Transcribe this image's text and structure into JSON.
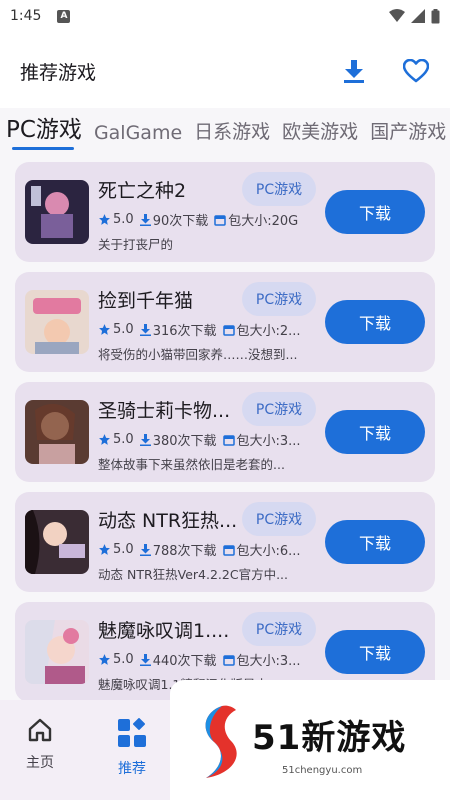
{
  "status": {
    "time": "1:45"
  },
  "header": {
    "title": "推荐游戏",
    "download_icon": "download-icon",
    "favorite_icon": "heart-icon"
  },
  "tabs": [
    {
      "label": "PC游戏",
      "active": true
    },
    {
      "label": "GalGame",
      "active": false
    },
    {
      "label": "日系游戏",
      "active": false
    },
    {
      "label": "欧美游戏",
      "active": false
    },
    {
      "label": "国产游戏",
      "active": false
    }
  ],
  "games": [
    {
      "name": "死亡之种2",
      "tag": "PC游戏",
      "rating": "5.0",
      "downloads": "90次下载",
      "size": "包大小:20G",
      "desc": "关于打丧尸的",
      "button": "下载"
    },
    {
      "name": "捡到千年猫",
      "tag": "PC游戏",
      "rating": "5.0",
      "downloads": "316次下载",
      "size": "包大小:2...",
      "desc": "将受伤的小猫带回家养……没想到...",
      "button": "下载"
    },
    {
      "name": "圣骑士莉卡物...",
      "tag": "PC游戏",
      "rating": "5.0",
      "downloads": "380次下载",
      "size": "包大小:3...",
      "desc": "整体故事下来虽然依旧是老套的...",
      "button": "下载"
    },
    {
      "name": "动态 NTR狂热...",
      "tag": "PC游戏",
      "rating": "5.0",
      "downloads": "788次下载",
      "size": "包大小:6...",
      "desc": "动态 NTR狂热Ver4.2.2C官方中...",
      "button": "下载"
    },
    {
      "name": "魅魔咏叹调1....",
      "tag": "PC游戏",
      "rating": "5.0",
      "downloads": "440次下载",
      "size": "包大小:3...",
      "desc": "魅魔咏叹调1.1精翻汉化版是丰...",
      "button": "下载"
    }
  ],
  "bottom_nav": [
    {
      "label": "主页",
      "icon": "home-icon",
      "active": false
    },
    {
      "label": "推荐",
      "icon": "grid-icon",
      "active": true
    }
  ],
  "watermark": {
    "text": "51新游戏",
    "url": "51chengyu.com"
  },
  "colors": {
    "accent": "#1e6fd9",
    "card": "#e8e0ee",
    "tag_bg": "#d6d9f1"
  }
}
